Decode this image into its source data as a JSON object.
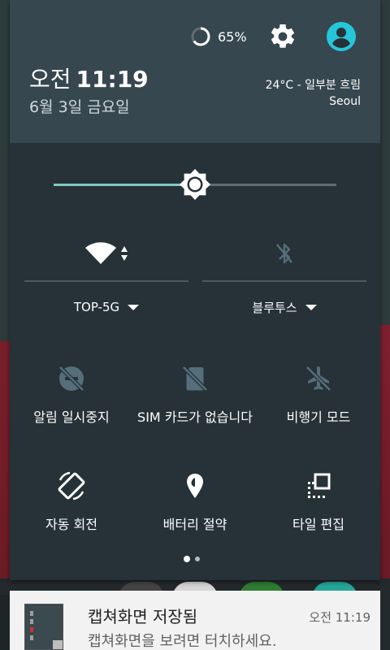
{
  "header": {
    "battery_percent": "65%",
    "battery_level": 0.65,
    "time_ampm": "오전",
    "time_clock": "11:19",
    "date": "6월 3일 금요일",
    "weather": "24°C - 일부분 흐림",
    "city": "Seoul",
    "icons": {
      "settings": "gear-icon",
      "user": "account-icon"
    }
  },
  "brightness": {
    "level": 0.5,
    "track_color": "#80cbc4"
  },
  "big_tiles": [
    {
      "label": "TOP-5G",
      "icon": "wifi-icon",
      "active": true
    },
    {
      "label": "블루투스",
      "icon": "bluetooth-off-icon",
      "active": false
    }
  ],
  "small_tiles": [
    {
      "label": "알림 일시중지",
      "icon": "do-not-disturb-off-icon"
    },
    {
      "label": "SIM 카드가 없습니다",
      "icon": "no-sim-icon"
    },
    {
      "label": "비행기 모드",
      "icon": "airplane-icon"
    },
    {
      "label": "자동 회전",
      "icon": "auto-rotate-icon"
    },
    {
      "label": "배터리 절약",
      "icon": "battery-saver-icon"
    },
    {
      "label": "타일 편집",
      "icon": "edit-tiles-icon"
    }
  ],
  "page_indicator": {
    "current": 1,
    "total": 2
  },
  "notification": {
    "title": "캡쳐화면 저장됨",
    "time": "오전 11:19",
    "body": "캡쳐화면을 보려면 터치하세요."
  },
  "colors": {
    "panel": "#263238",
    "header": "#37474f",
    "accent": "#80cbc4",
    "avatar": "#26c6da"
  }
}
